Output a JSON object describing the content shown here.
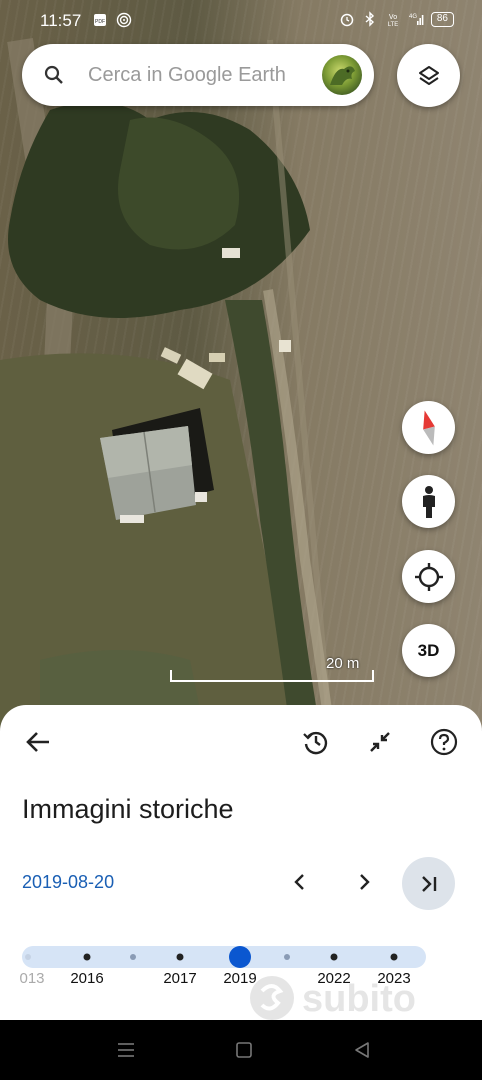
{
  "status_bar": {
    "time": "11:57",
    "battery": "86",
    "icons": [
      "notification-icon",
      "pdf-icon",
      "nfc-icon",
      "alarm-icon",
      "bluetooth-icon",
      "volte-icon",
      "signal-4g-icon",
      "battery-icon"
    ]
  },
  "search": {
    "placeholder": "Cerca in Google Earth"
  },
  "map": {
    "scale_label": "20 m"
  },
  "controls": {
    "three_d_label": "3D"
  },
  "sheet": {
    "title": "Immagini storiche",
    "date": "2019-08-20"
  },
  "timeline": {
    "labels": [
      "013",
      "2016",
      "2017",
      "2019",
      "2022",
      "2023"
    ],
    "selected": "2019"
  },
  "colors": {
    "accent": "#0b57d0",
    "date_link": "#1a5fb4",
    "timeline_track": "#d6e4f6"
  }
}
